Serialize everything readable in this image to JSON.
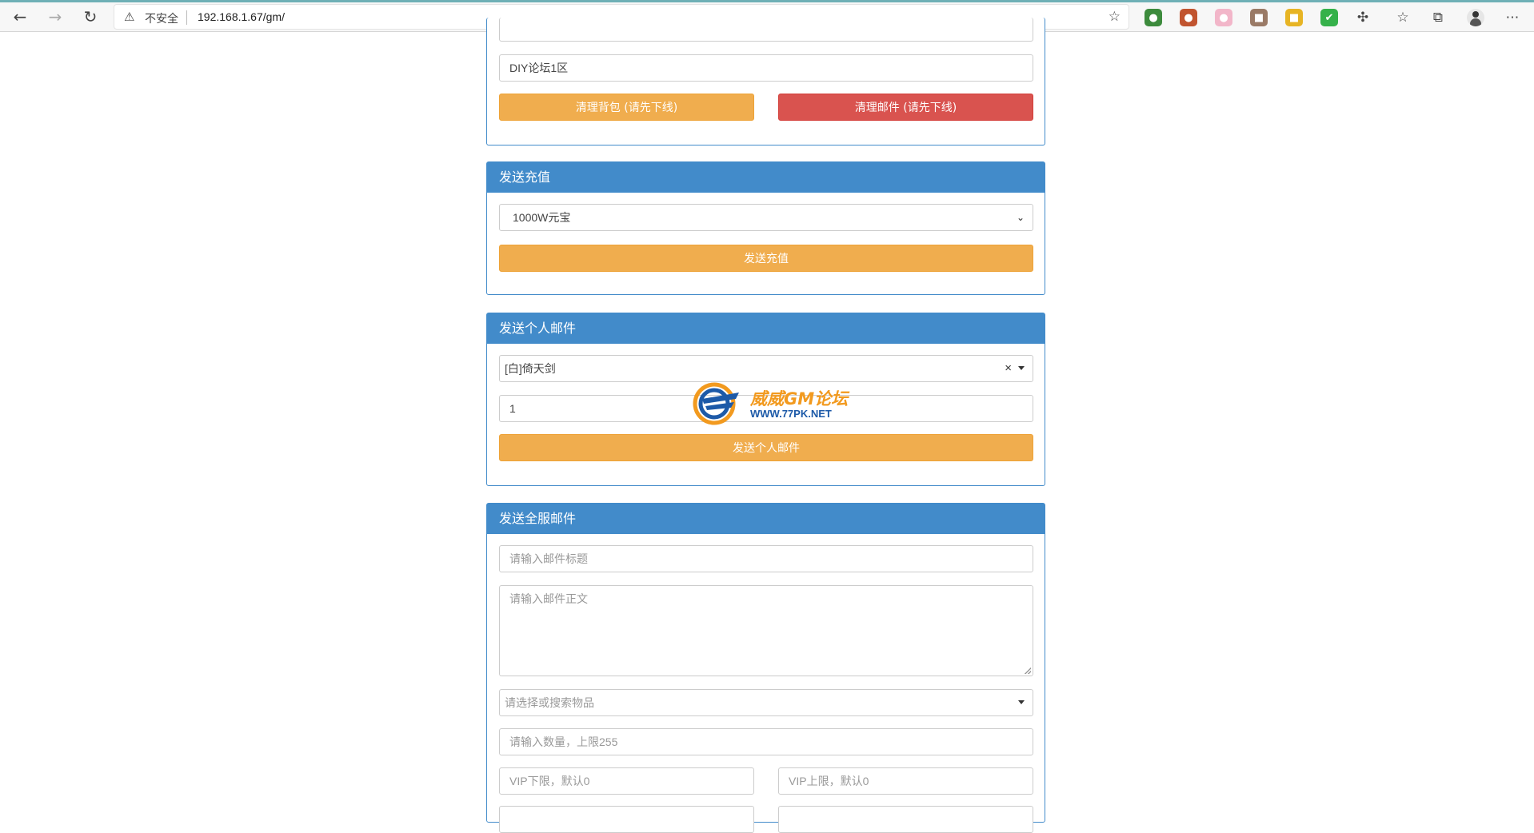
{
  "browser": {
    "security_label": "不安全",
    "url": "192.168.1.67/gm/",
    "extensions": [
      {
        "name": "ext-green-icon",
        "color": "#3d8b3d",
        "glyph": "●"
      },
      {
        "name": "ext-fox-icon",
        "color": "#c1542f",
        "glyph": "●"
      },
      {
        "name": "ext-pink-icon",
        "color": "#f2b6c9",
        "glyph": "●"
      },
      {
        "name": "ext-book-icon",
        "color": "#9a7a66",
        "glyph": "■"
      },
      {
        "name": "ext-folder-icon",
        "color": "#e7b424",
        "glyph": "■"
      },
      {
        "name": "ext-shield-icon",
        "color": "#35b14a",
        "glyph": "✔"
      }
    ]
  },
  "top_panel": {
    "server_value": "DIY论坛1区",
    "clear_bag_label": "清理背包 (请先下线)",
    "clear_mail_label": "清理邮件 (请先下线)"
  },
  "recharge_panel": {
    "title": "发送充值",
    "selected_option": "1000W元宝",
    "submit_label": "发送充值"
  },
  "personal_mail_panel": {
    "title": "发送个人邮件",
    "item_value": "[白]倚天剑",
    "quantity_value": "1",
    "submit_label": "发送个人邮件"
  },
  "server_mail_panel": {
    "title": "发送全服邮件",
    "subject_placeholder": "请输入邮件标题",
    "body_placeholder": "请输入邮件正文",
    "item_placeholder": "请选择或搜索物品",
    "quantity_placeholder": "请输入数量，上限255",
    "vip_min_placeholder": "VIP下限，默认0",
    "vip_max_placeholder": "VIP上限，默认0"
  },
  "watermark": {
    "title": "威威GM论坛",
    "url": "WWW.77PK.NET"
  },
  "colors": {
    "primary": "#428bca",
    "warning": "#f0ad4e",
    "danger": "#d9534f"
  }
}
